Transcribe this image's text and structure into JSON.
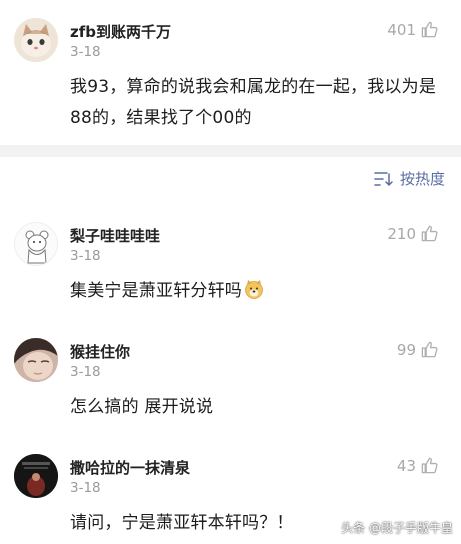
{
  "sort": {
    "label": "按热度",
    "icon": "sort-lines-icon"
  },
  "comments": [
    {
      "name": "zfb到账两千万",
      "date": "3-18",
      "likes": "401",
      "text": "我93，算命的说我会和属龙的在一起，我以为是88的，结果找了个00的",
      "avatar": "cat-avatar"
    },
    {
      "name": "梨子哇哇哇哇",
      "date": "3-18",
      "likes": "210",
      "text": "集美宁是萧亚轩分轩吗",
      "avatar": "cartoon-bear-avatar",
      "emoji": "doge-emoji-icon"
    },
    {
      "name": "猴挂住你",
      "date": "3-18",
      "likes": "99",
      "text": "怎么搞的 展开说说",
      "avatar": "face-avatar"
    },
    {
      "name": "撒哈拉的一抹清泉",
      "date": "3-18",
      "likes": "43",
      "text": "请问，宁是萧亚轩本轩吗？！",
      "avatar": "dark-photo-avatar"
    }
  ],
  "watermark": "头条 @段子手版牛皇",
  "colors": {
    "accent": "#5b6ea3",
    "muted": "#9a9a9a",
    "divider": "#f2f2f2"
  }
}
